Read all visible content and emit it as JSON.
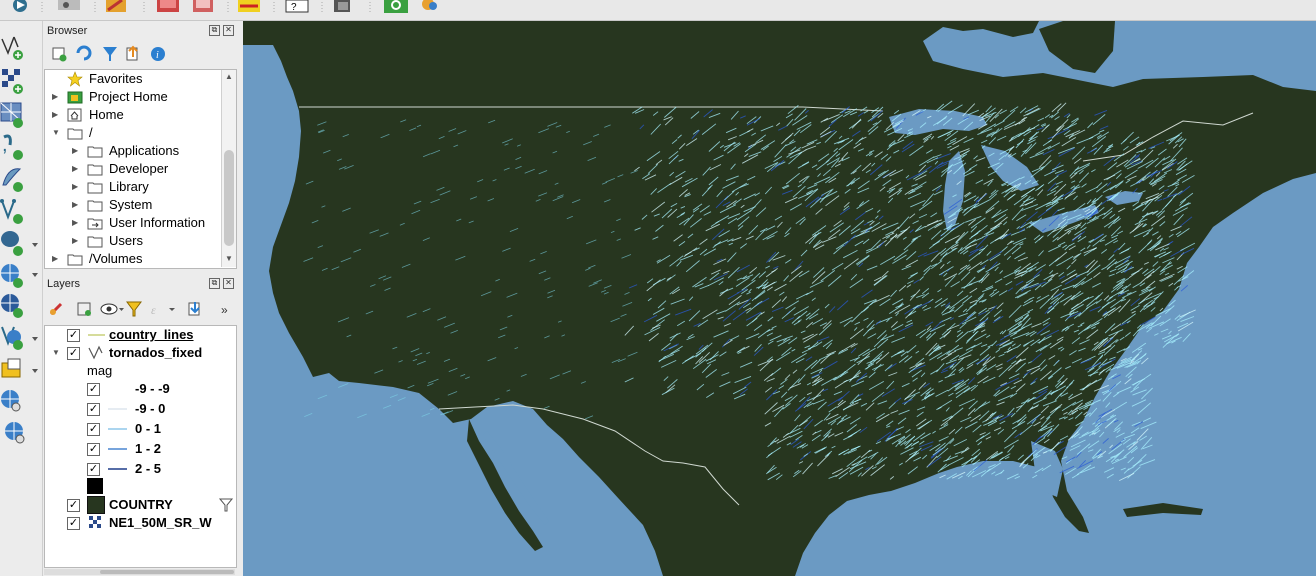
{
  "colors": {
    "ocean": "#6b9ac3",
    "land": "#27361f",
    "border": "#cfd8d0",
    "tornado_light": "#9ff0ff",
    "tornado_dark": "#2a5bd6"
  },
  "toolbar": {
    "icons": [
      "run-script-icon",
      "zoom-tool-icon",
      "edit-icon",
      "digitize-icon",
      "grid-icon",
      "select-icon",
      "identify-icon",
      "measure-icon",
      "zoom-in-icon",
      "plugin-icon"
    ]
  },
  "left_toolbar": {
    "icons": [
      "new-vector-layer-icon",
      "raster-layer-icon",
      "mesh-layer-icon",
      "delimited-text-layer-icon",
      "spatialite-layer-icon",
      "virtual-layer-icon",
      "postgis-layer-icon",
      "wms-layer-icon",
      "wcs-layer-icon",
      "wfs-layer-icon",
      "oracle-layer-icon",
      "xyz-layer-icon",
      "vector-tile-layer-icon"
    ]
  },
  "browser": {
    "title": "Browser",
    "items": [
      {
        "label": "Favorites",
        "icon": "star-icon",
        "level": 0,
        "arrow": ""
      },
      {
        "label": "Project Home",
        "icon": "project-home-icon",
        "level": 0,
        "arrow": "▶"
      },
      {
        "label": "Home",
        "icon": "home-icon",
        "level": 0,
        "arrow": "▶"
      },
      {
        "label": "/",
        "icon": "folder-icon",
        "level": 0,
        "arrow": "▼"
      },
      {
        "label": "Applications",
        "icon": "folder-icon",
        "level": 1,
        "arrow": "▶"
      },
      {
        "label": "Developer",
        "icon": "folder-icon",
        "level": 1,
        "arrow": "▶"
      },
      {
        "label": "Library",
        "icon": "folder-icon",
        "level": 1,
        "arrow": "▶"
      },
      {
        "label": "System",
        "icon": "folder-icon",
        "level": 1,
        "arrow": "▶"
      },
      {
        "label": "User Information",
        "icon": "folder-link-icon",
        "level": 1,
        "arrow": "▶"
      },
      {
        "label": "Users",
        "icon": "folder-icon",
        "level": 1,
        "arrow": "▶"
      },
      {
        "label": "/Volumes",
        "icon": "folder-icon",
        "level": 0,
        "arrow": "▶"
      }
    ]
  },
  "layers": {
    "title": "Layers",
    "items": [
      {
        "label": "country_lines",
        "checked": true,
        "bold": true,
        "underline": true
      },
      {
        "label": "tornados_fixed",
        "checked": true,
        "bold": true
      },
      {
        "label": "COUNTRY",
        "checked": true,
        "bold": true
      },
      {
        "label": "NE1_50M_SR_W",
        "checked": true,
        "bold": true
      }
    ],
    "field": "mag",
    "classes": [
      {
        "label": "-9 - -9",
        "color": "#ffffff"
      },
      {
        "label": "-9 - 0",
        "color": "#dde6ee"
      },
      {
        "label": "0 - 1",
        "color": "#8fc7ea"
      },
      {
        "label": "1 - 2",
        "color": "#4a86d0"
      },
      {
        "label": "2 - 5",
        "color": "#1f3d8a"
      }
    ]
  }
}
